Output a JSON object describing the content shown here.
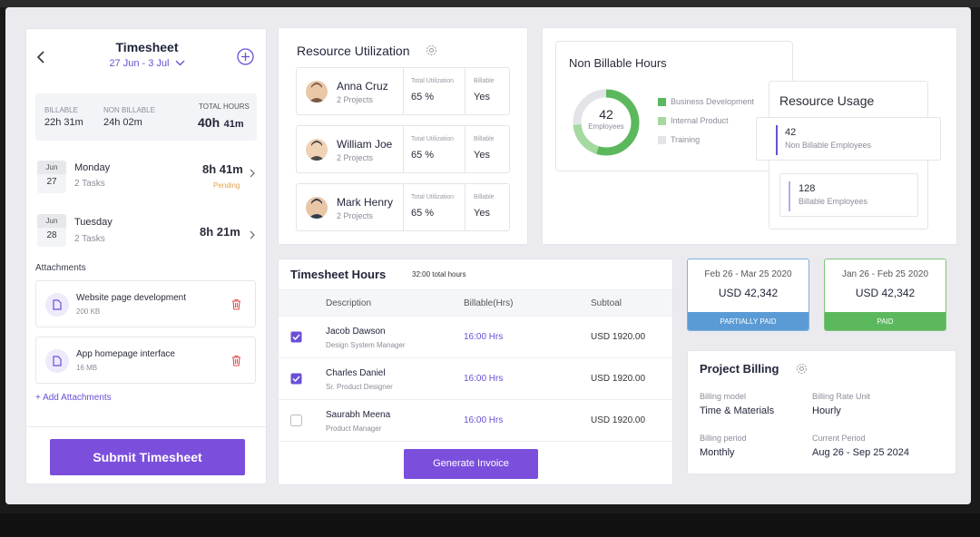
{
  "timesheet": {
    "title": "Timesheet",
    "date_range": "27 Jun - 3 Jul",
    "summary": {
      "billable_label": "BILLABLE",
      "billable_value": "22h 31m",
      "non_billable_label": "NON BILLABLE",
      "non_billable_value": "24h 02m",
      "total_label": "TOTAL HOURS",
      "total_value_main": "40h",
      "total_value_min": "41m"
    },
    "days": [
      {
        "month": "Jun",
        "day": "27",
        "name": "Monday",
        "tasks": "2 Tasks",
        "hours": "8h 41m",
        "status": "Pending"
      },
      {
        "month": "Jun",
        "day": "28",
        "name": "Tuesday",
        "tasks": "2 Tasks",
        "hours": "8h 21m",
        "status": ""
      }
    ],
    "attachments_label": "Attachments",
    "attachments": [
      {
        "name": "Website page development",
        "size": "200 KB"
      },
      {
        "name": "App homepage interface",
        "size": "16 MB"
      }
    ],
    "add_attachments": "+ Add Attachments",
    "submit_label": "Submit Timesheet"
  },
  "resource_utilization": {
    "title": "Resource Utilization",
    "util_label": "Total Utilization",
    "billable_label": "Billable",
    "people": [
      {
        "name": "Anna Cruz",
        "projects": "2 Projects",
        "utilization": "65 %",
        "billable": "Yes"
      },
      {
        "name": "William Joe",
        "projects": "2 Projects",
        "utilization": "65 %",
        "billable": "Yes"
      },
      {
        "name": "Mark Henry",
        "projects": "2 Projects",
        "utilization": "65 %",
        "billable": "Yes"
      }
    ]
  },
  "non_billable": {
    "title": "Non Billable Hours",
    "center_value": "42",
    "center_label": "Employees",
    "legend": [
      {
        "label": "Business Development",
        "color": "#5cb85c"
      },
      {
        "label": "Internal Product",
        "color": "#a4d9a0"
      },
      {
        "label": "Training",
        "color": "#e3e4e8"
      }
    ]
  },
  "resource_usage": {
    "title": "Resource Usage",
    "items": [
      {
        "value": "42",
        "label": "Non Billable Employees"
      },
      {
        "value": "128",
        "label": "Billable Employees"
      }
    ]
  },
  "timesheet_hours": {
    "title": "Timesheet Hours",
    "total": "32:00 total hours",
    "columns": [
      "Description",
      "Billable(Hrs)",
      "Subtoal"
    ],
    "rows": [
      {
        "name": "Jacob Dawson",
        "role": "Design System Manager",
        "hours": "16:00 Hrs",
        "subtotal": "USD 1920.00",
        "checked": true
      },
      {
        "name": "Charles Daniel",
        "role": "Sr. Product Designer",
        "hours": "16:00 Hrs",
        "subtotal": "USD 1920.00",
        "checked": true
      },
      {
        "name": "Saurabh Meena",
        "role": "Product Manager",
        "hours": "16:00 Hrs",
        "subtotal": "USD 1920.00",
        "checked": false
      }
    ],
    "generate_label": "Generate Invoice"
  },
  "invoices": [
    {
      "range": "Feb 26 - Mar 25 2020",
      "amount": "USD 42,342",
      "status": "PARTIALLY PAID",
      "color": "#5b9bd5"
    },
    {
      "range": "Jan 26 - Feb 25 2020",
      "amount": "USD 42,342",
      "status": "PAID",
      "color": "#5cb85c"
    }
  ],
  "project_billing": {
    "title": "Project Billing",
    "fields": [
      {
        "label": "Billing model",
        "value": "Time & Materials"
      },
      {
        "label": "Billing Rate Unit",
        "value": "Hourly"
      },
      {
        "label": "Billing period",
        "value": "Monthly"
      },
      {
        "label": "Current Period",
        "value": "Aug 26 - Sep 25 2024"
      }
    ]
  },
  "colors": {
    "accent": "#7b4fdc",
    "partial": "#5b9bd5",
    "paid": "#5cb85c"
  }
}
